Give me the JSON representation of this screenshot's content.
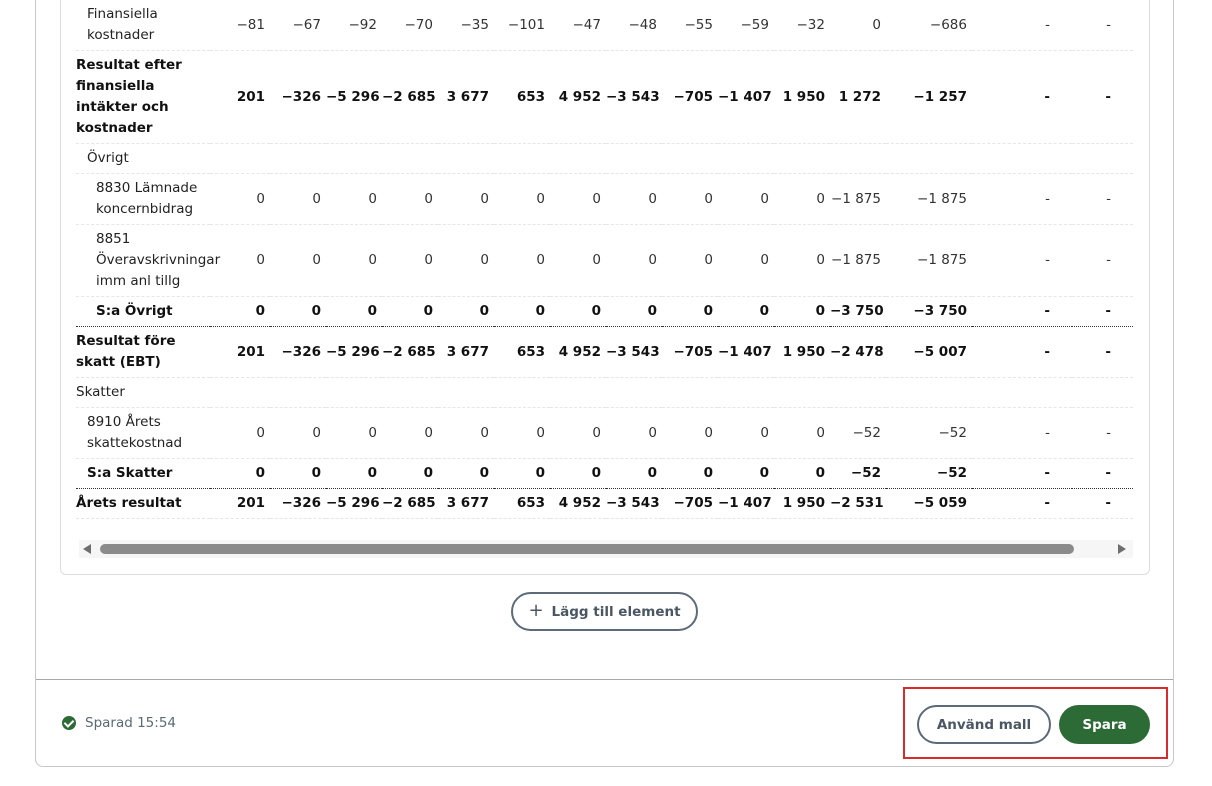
{
  "table": {
    "rows": [
      {
        "type": "ind1",
        "label": "Finansiella kostnader",
        "values": [
          "−81",
          "−67",
          "−92",
          "−70",
          "−35",
          "−101",
          "−47",
          "−48",
          "−55",
          "−59",
          "−32",
          "0",
          "−686",
          "-",
          "-"
        ]
      },
      {
        "type": "bold",
        "label": "Resultat efter finansiella intäkter och kostnader",
        "values": [
          "201",
          "−326",
          "−5 296",
          "−2 685",
          "3 677",
          "653",
          "4 952",
          "−3 543",
          "−705",
          "−1 407",
          "1 950",
          "1 272",
          "−1 257",
          "-",
          "-"
        ]
      },
      {
        "type": "ind1",
        "label": "Övrigt",
        "values": []
      },
      {
        "type": "ind2",
        "label": "8830 Lämnade koncernbidrag",
        "values": [
          "0",
          "0",
          "0",
          "0",
          "0",
          "0",
          "0",
          "0",
          "0",
          "0",
          "0",
          "−1 875",
          "−1 875",
          "-",
          "-"
        ]
      },
      {
        "type": "ind2",
        "label": "8851 Överavskrivningar imm anl tillg",
        "values": [
          "0",
          "0",
          "0",
          "0",
          "0",
          "0",
          "0",
          "0",
          "0",
          "0",
          "0",
          "−1 875",
          "−1 875",
          "-",
          "-"
        ]
      },
      {
        "type": "ind2 bold sum",
        "label": "S:a Övrigt",
        "values": [
          "0",
          "0",
          "0",
          "0",
          "0",
          "0",
          "0",
          "0",
          "0",
          "0",
          "0",
          "−3 750",
          "−3 750",
          "-",
          "-"
        ]
      },
      {
        "type": "bold",
        "label": "Resultat före skatt (EBT)",
        "values": [
          "201",
          "−326",
          "−5 296",
          "−2 685",
          "3 677",
          "653",
          "4 952",
          "−3 543",
          "−705",
          "−1 407",
          "1 950",
          "−2 478",
          "−5 007",
          "-",
          "-"
        ]
      },
      {
        "type": "",
        "label": "Skatter",
        "values": []
      },
      {
        "type": "ind1",
        "label": "8910 Årets skattekostnad",
        "values": [
          "0",
          "0",
          "0",
          "0",
          "0",
          "0",
          "0",
          "0",
          "0",
          "0",
          "0",
          "−52",
          "−52",
          "-",
          "-"
        ]
      },
      {
        "type": "ind1 bold sum",
        "label": "S:a Skatter",
        "values": [
          "0",
          "0",
          "0",
          "0",
          "0",
          "0",
          "0",
          "0",
          "0",
          "0",
          "0",
          "−52",
          "−52",
          "-",
          "-"
        ]
      },
      {
        "type": "bold",
        "label": "Årets resultat",
        "values": [
          "201",
          "−326",
          "−5 296",
          "−2 685",
          "3 677",
          "653",
          "4 952",
          "−3 543",
          "−705",
          "−1 407",
          "1 950",
          "−2 531",
          "−5 059",
          "-",
          "-"
        ]
      }
    ]
  },
  "add_element": {
    "label": "Lägg till element",
    "icon": "plus-icon"
  },
  "footer": {
    "status_icon": "check-circle-icon",
    "status_text": "Sparad 15:54",
    "use_template_label": "Använd mall",
    "save_label": "Spara"
  },
  "colors": {
    "primary": "#2d6b36",
    "outline": "#5d6b78",
    "highlight": "#d92b2b"
  }
}
